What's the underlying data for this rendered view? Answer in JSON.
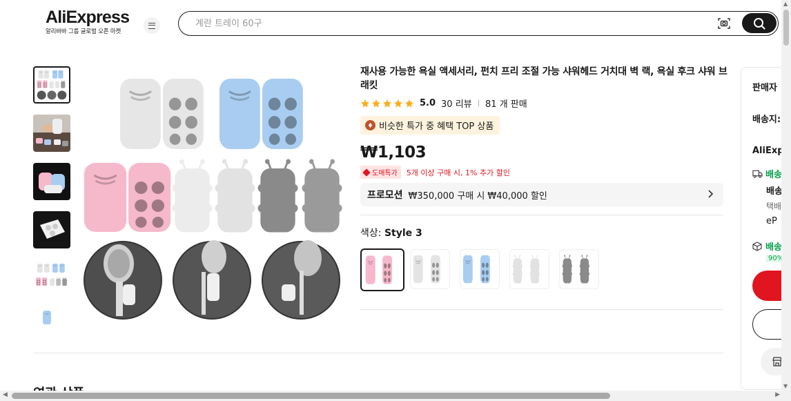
{
  "header": {
    "logo": "AliExpress",
    "tagline": "알리바바 그룹 글로벌 오픈 마켓",
    "search_placeholder": "계란 트레이 60구"
  },
  "product": {
    "title": "재사용 가능한 욕실 액세서리, 펀치 프리 조절 가능 샤워헤드 거치대 벽 랙, 욕실 후크 샤워 브래킷",
    "rating": "5.0",
    "reviews": "30 리뷰",
    "sold": "81 개 판매",
    "badge": "비슷한 특가 중 혜택 TOP 상품",
    "price": "₩1,103",
    "bulk_tag": "도매특가",
    "bulk_text": "5개 이상 구매 시, 1% 추가 할인",
    "promo_title": "프로모션",
    "promo_text": "₩350,000 구매 시 ₩40,000 할인",
    "color_label": "색상:",
    "color_value": "Style 3",
    "swatches": [
      "pink",
      "white",
      "blue",
      "white-antenna",
      "gray-antenna"
    ],
    "selected_swatch": "pink"
  },
  "side": {
    "seller": "판매자",
    "ship_to": "배송지:",
    "brand": "AliExp",
    "shipping_label": "배송",
    "shipping_line2": "배송",
    "courier": "택배",
    "epc": "eP",
    "guarantee": "배송",
    "guarantee_tag": "90%"
  },
  "related_title": "연관 상품",
  "colors": {
    "accent": "#e0151f",
    "green": "#00a046",
    "star": "#fcae1c",
    "badge_bg": "#fff3df",
    "pink": "#f6b8cb",
    "blue": "#a9cdf0",
    "white": "#e6e6e6",
    "gray": "#8a8a8a"
  },
  "icons": [
    "menu-icon",
    "camera-search-icon",
    "search-icon",
    "star-icon",
    "medal-icon",
    "tag-icon",
    "chevron-right-icon",
    "truck-icon",
    "box-icon",
    "store-icon"
  ]
}
